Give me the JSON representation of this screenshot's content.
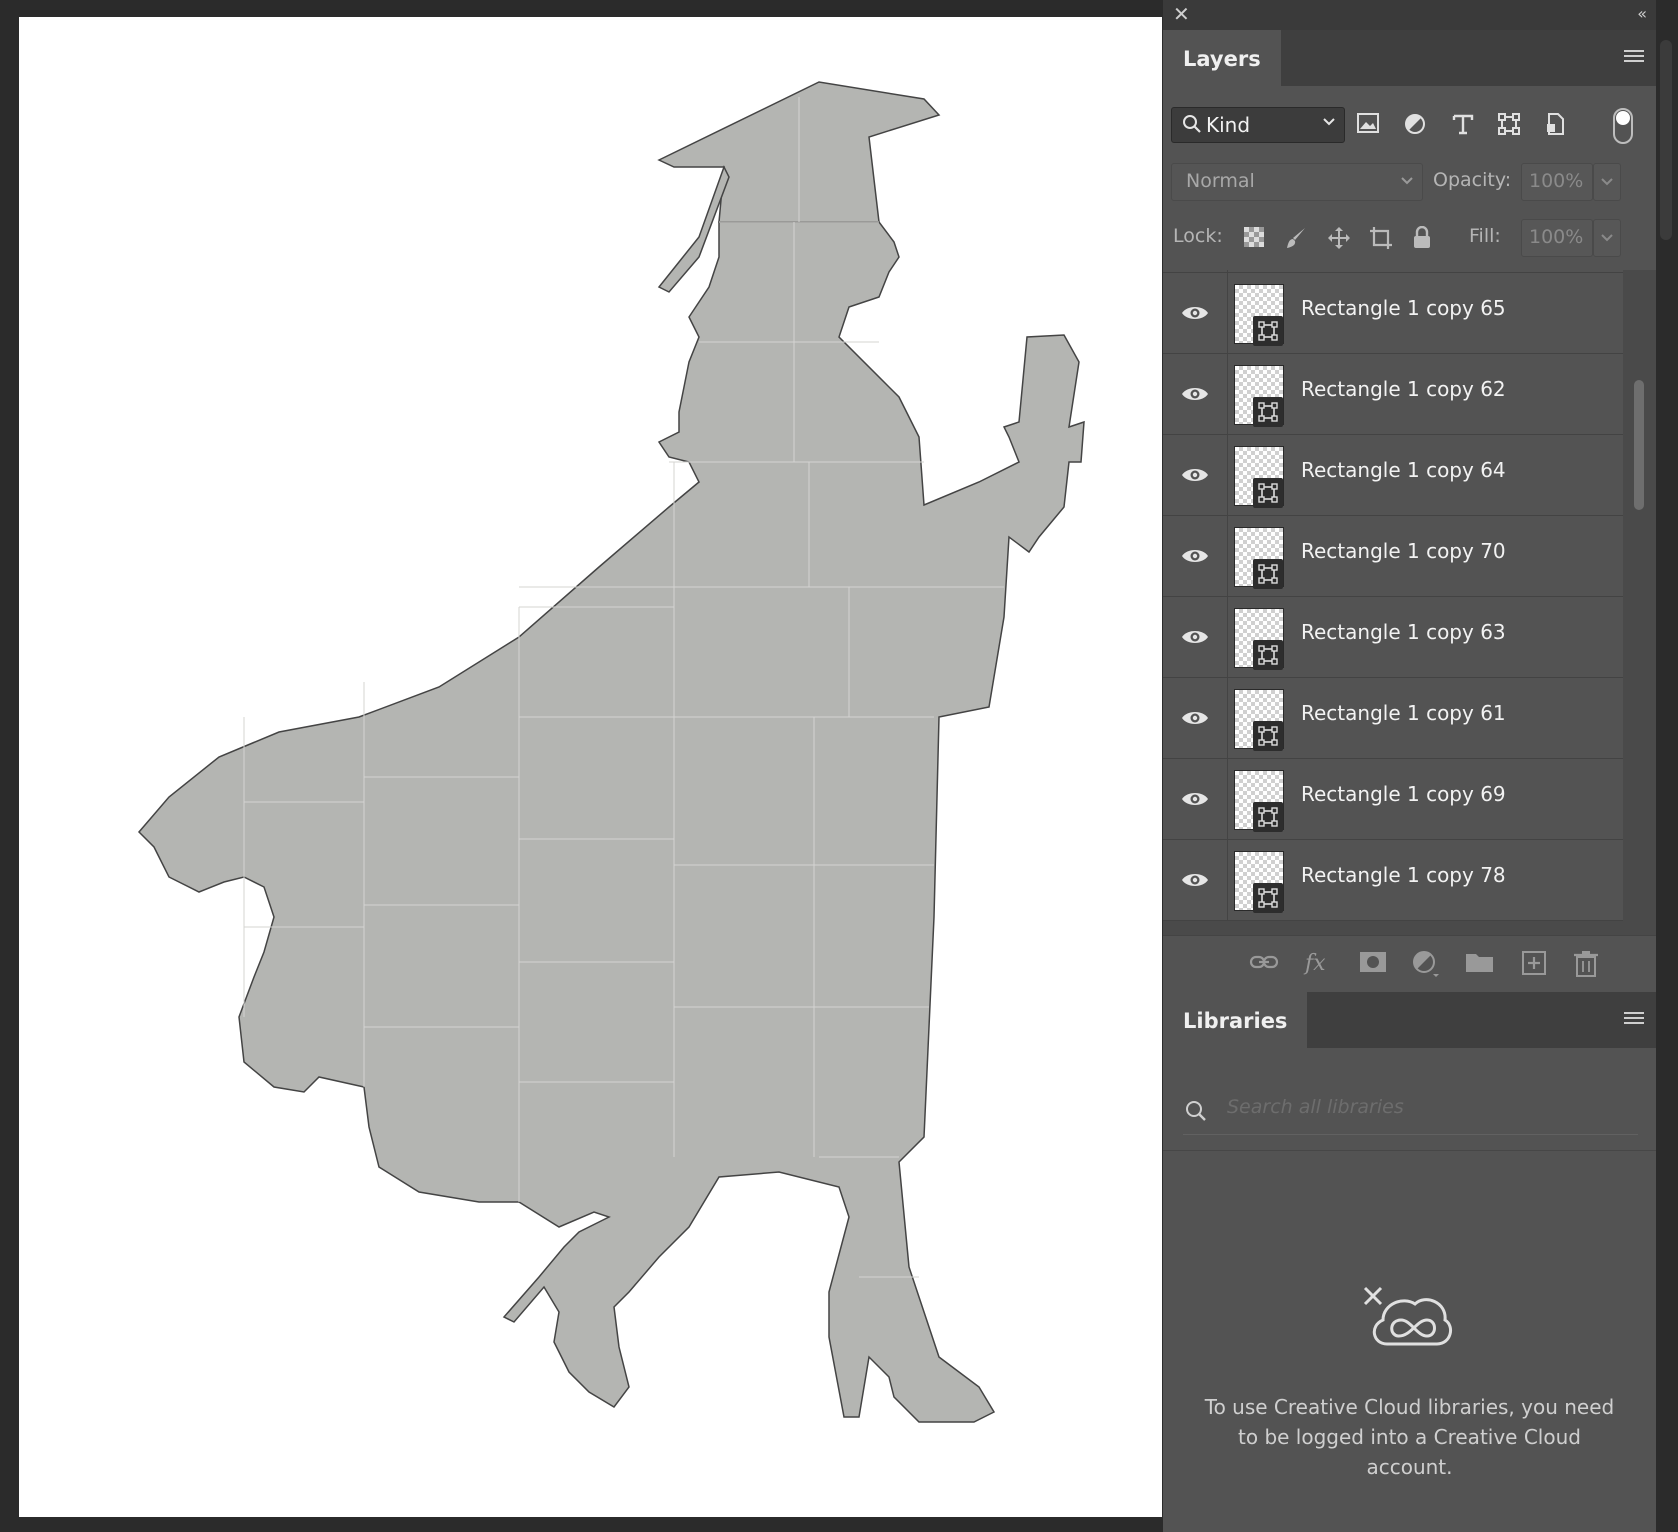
{
  "layers_panel": {
    "tab_label": "Layers",
    "filter": {
      "kind_label": "Kind"
    },
    "blend_mode": "Normal",
    "opacity_label": "Opacity:",
    "opacity_value": "100%",
    "lock_label": "Lock:",
    "fill_label": "Fill:",
    "fill_value": "100%",
    "layers": [
      {
        "name": "Rectangle 1 copy 65",
        "visible": true
      },
      {
        "name": "Rectangle 1 copy 62",
        "visible": true
      },
      {
        "name": "Rectangle 1 copy 64",
        "visible": true
      },
      {
        "name": "Rectangle 1 copy 70",
        "visible": true
      },
      {
        "name": "Rectangle 1 copy 63",
        "visible": true
      },
      {
        "name": "Rectangle 1 copy 61",
        "visible": true
      },
      {
        "name": "Rectangle 1 copy 69",
        "visible": true
      },
      {
        "name": "Rectangle 1 copy 78",
        "visible": true
      }
    ],
    "footer_icons": [
      "link-icon",
      "fx-icon",
      "mask-icon",
      "adjustment-icon",
      "folder-icon",
      "new-layer-icon",
      "trash-icon"
    ]
  },
  "libraries_panel": {
    "tab_label": "Libraries",
    "search_placeholder": "Search all libraries",
    "message": "To use Creative Cloud libraries, you need to be logged into a Creative Cloud account."
  },
  "colors": {
    "panel_bg": "#535353",
    "silhouette_fill": "#b4b5b2",
    "canvas_bg": "#ffffff"
  }
}
